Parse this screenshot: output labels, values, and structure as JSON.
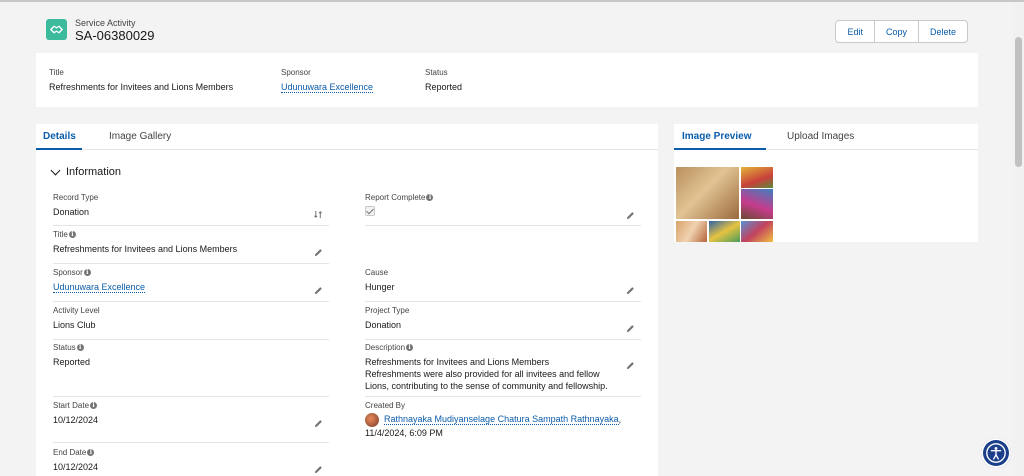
{
  "header": {
    "object_type": "Service Activity",
    "record_name": "SA-06380029",
    "buttons": {
      "edit": "Edit",
      "copy": "Copy",
      "delete": "Delete"
    }
  },
  "highlights": {
    "title_label": "Title",
    "title_value": "Refreshments for Invitees and Lions Members",
    "sponsor_label": "Sponsor",
    "sponsor_value": "Udunuwara Excellence",
    "status_label": "Status",
    "status_value": "Reported"
  },
  "tabs": {
    "details": "Details",
    "gallery": "Image Gallery"
  },
  "section": {
    "title": "Information"
  },
  "fields": {
    "record_type": {
      "label": "Record Type",
      "value": "Donation"
    },
    "title": {
      "label": "Title",
      "value": "Refreshments for Invitees and Lions Members"
    },
    "sponsor": {
      "label": "Sponsor",
      "value": "Udunuwara Excellence"
    },
    "activity_level": {
      "label": "Activity Level",
      "value": "Lions Club"
    },
    "status": {
      "label": "Status",
      "value": "Reported"
    },
    "start_date": {
      "label": "Start Date",
      "value": "10/12/2024"
    },
    "end_date": {
      "label": "End Date",
      "value": "10/12/2024"
    },
    "report_complete": {
      "label": "Report Complete",
      "checked": true
    },
    "cause": {
      "label": "Cause",
      "value": "Hunger"
    },
    "project_type": {
      "label": "Project Type",
      "value": "Donation"
    },
    "description": {
      "label": "Description",
      "line1": "Refreshments for Invitees and Lions Members",
      "line2": "Refreshments were also provided for all invitees and fellow",
      "line3": "Lions, contributing to the sense of community and fellowship."
    },
    "created_by": {
      "label": "Created By",
      "user": "Rathnayaka Mudiyanselage Chatura Sampath Rathnayaka",
      "sep": ",",
      "datetime": "11/4/2024, 6:09 PM"
    }
  },
  "right_tabs": {
    "preview": "Image Preview",
    "upload": "Upload Images"
  },
  "colors": {
    "brand": "#0b5cab",
    "record_icon": "#3bba9c",
    "accessibility": "#1b3f8a"
  },
  "icons": [
    "handshake-icon",
    "pencil-icon",
    "info-icon",
    "change-record-type-icon",
    "chevron-down-icon",
    "accessibility-icon"
  ]
}
